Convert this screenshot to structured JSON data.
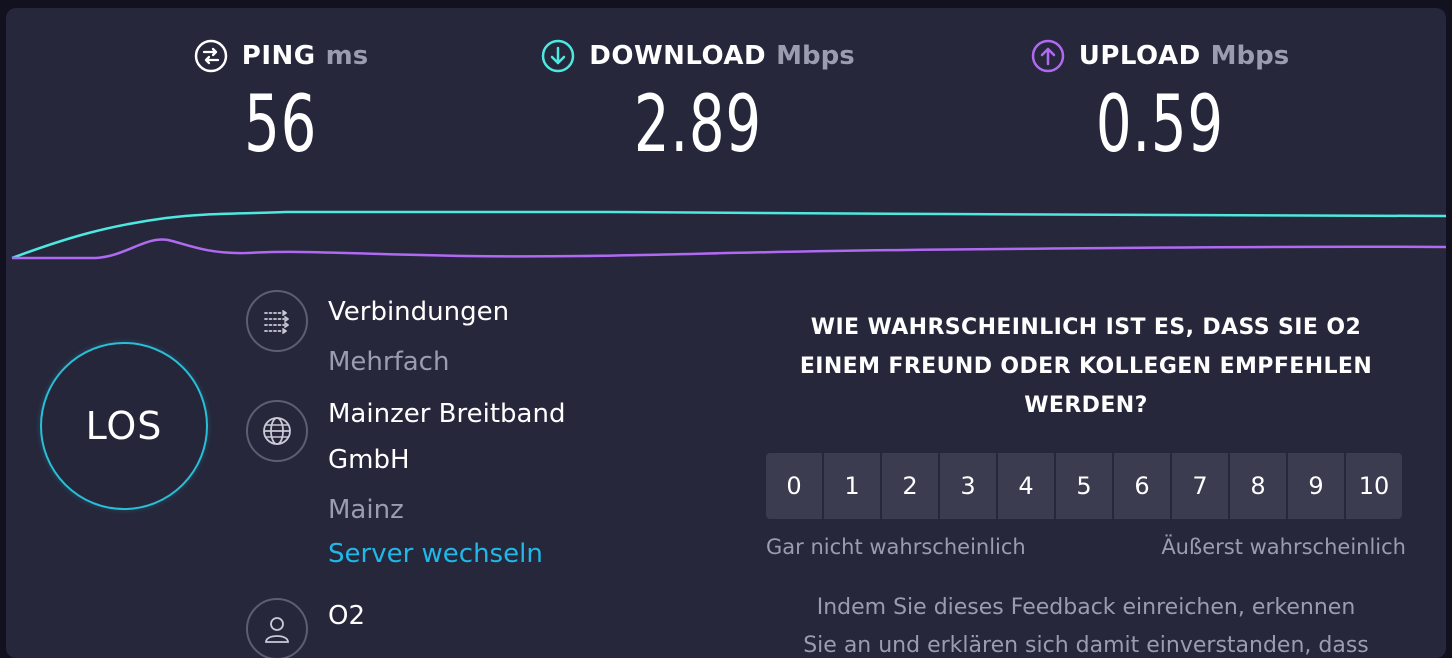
{
  "metrics": {
    "ping": {
      "label": "PING",
      "unit": "ms",
      "value": "56"
    },
    "download": {
      "label": "DOWNLOAD",
      "unit": "Mbps",
      "value": "2.89"
    },
    "upload": {
      "label": "UPLOAD",
      "unit": "Mbps",
      "value": "0.59"
    }
  },
  "colors": {
    "download": "#4de8e0",
    "upload": "#b06af2",
    "accent_link": "#1fb8e8",
    "go_ring": "#29bfd6"
  },
  "go_button": {
    "label": "LOS"
  },
  "connection": {
    "connections_title": "Verbindungen",
    "connections_value": "Mehrfach",
    "server_name_line1": "Mainzer Breitband",
    "server_name_line2": "GmbH",
    "server_location": "Mainz",
    "change_server": "Server wechseln",
    "provider": "O2"
  },
  "icons": {
    "ping": "ping-icon",
    "download": "download-arrow-icon",
    "upload": "upload-arrow-icon",
    "connections": "multiple-connections-icon",
    "server": "globe-icon",
    "provider": "user-icon"
  },
  "survey": {
    "question_line1": "WIE WAHRSCHEINLICH IST ES, DASS SIE O2",
    "question_line2": "EINEM FREUND ODER KOLLEGEN EMPFEHLEN",
    "question_line3": "WERDEN?",
    "scale": [
      "0",
      "1",
      "2",
      "3",
      "4",
      "5",
      "6",
      "7",
      "8",
      "9",
      "10"
    ],
    "low_label": "Gar nicht wahrscheinlich",
    "high_label": "Äußerst wahrscheinlich",
    "disclaimer_line1": "Indem Sie dieses Feedback einreichen, erkennen",
    "disclaimer_line2": "Sie an und erklären sich damit einverstanden, dass"
  }
}
